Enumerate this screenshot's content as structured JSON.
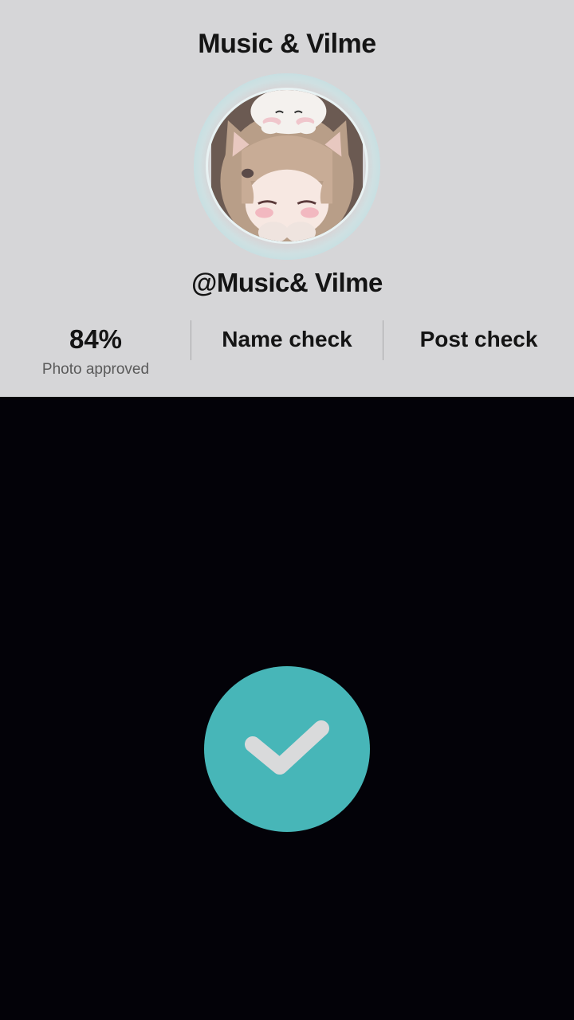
{
  "profile": {
    "display_name": "Music & Vilme",
    "username": "@Music& Vilme",
    "avatar_icon": "anime-girl-avatar"
  },
  "stats": {
    "photo": {
      "value": "84%",
      "label": "Photo approved"
    },
    "name_check": {
      "label": "Name check"
    },
    "post_check": {
      "label": "Post check"
    }
  },
  "approve": {
    "icon": "checkmark-icon",
    "color": "#47b6b8"
  },
  "colors": {
    "panel_bg": "#d6d6d8",
    "page_bg": "#030208",
    "accent": "#47b6b8"
  }
}
